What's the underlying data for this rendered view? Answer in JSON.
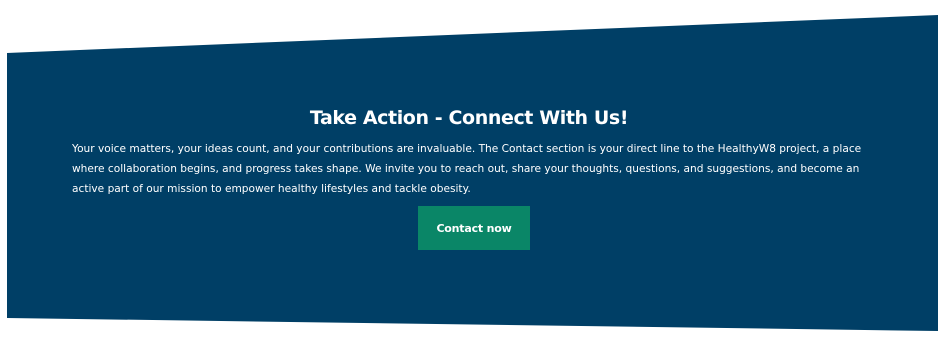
{
  "section": {
    "title": "Take Action - Connect With Us!",
    "body": "Your voice matters, your ideas count, and your contributions are invaluable. The Contact section is your direct line to the HealthyW8 project, a place where collaboration begins, and progress takes shape. We invite you to reach out, share your thoughts, questions, and suggestions, and become an active part of our mission to empower healthy lifestyles and tackle obesity.",
    "cta_label": "Contact now"
  },
  "colors": {
    "banner_background": "#003f66",
    "button_background": "#0a8667",
    "text": "#ffffff",
    "page_background": "#ffffff"
  }
}
